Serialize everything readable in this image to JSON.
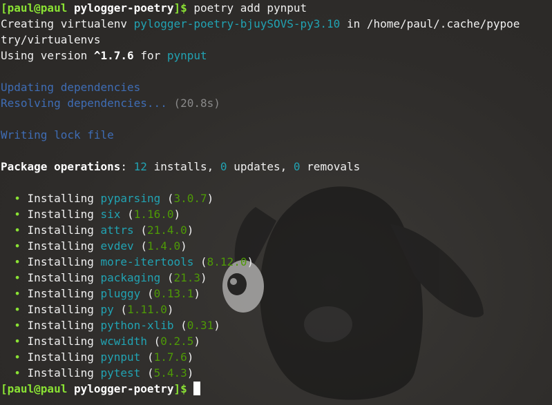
{
  "prompt": {
    "user_host": "[paul@paul",
    "cwd": "pylogger-poetry",
    "close": "]$"
  },
  "command": "poetry add pynput",
  "venv": {
    "prefix": "Creating virtualenv",
    "name": "pylogger-poetry-bjuySOVS-py3.10",
    "mid": "in",
    "path_part1": "/home/paul/.cache/pypoe",
    "path_part2": "try/virtualenvs"
  },
  "version_line": {
    "prefix": "Using version",
    "version": "^1.7.6",
    "for": "for",
    "package": "pynput"
  },
  "updating": "Updating dependencies",
  "resolving": {
    "text": "Resolving dependencies...",
    "time": "(20.8s)"
  },
  "writing": "Writing lock file",
  "operations": {
    "label": "Package operations",
    "installs_count": "12",
    "installs_label": "installs,",
    "updates_count": "0",
    "updates_label": "updates,",
    "removals_count": "0",
    "removals_label": "removals"
  },
  "install_verb": "Installing",
  "bullet": "•",
  "packages": [
    {
      "name": "pyparsing",
      "version": "3.0.7"
    },
    {
      "name": "six",
      "version": "1.16.0"
    },
    {
      "name": "attrs",
      "version": "21.4.0"
    },
    {
      "name": "evdev",
      "version": "1.4.0"
    },
    {
      "name": "more-itertools",
      "version": "8.12.0"
    },
    {
      "name": "packaging",
      "version": "21.3"
    },
    {
      "name": "pluggy",
      "version": "0.13.1"
    },
    {
      "name": "py",
      "version": "1.11.0"
    },
    {
      "name": "python-xlib",
      "version": "0.31"
    },
    {
      "name": "wcwidth",
      "version": "0.2.5"
    },
    {
      "name": "pynput",
      "version": "1.7.6"
    },
    {
      "name": "pytest",
      "version": "5.4.3"
    }
  ],
  "colors": {
    "background": "#302e2c",
    "prompt_green": "#8ae234",
    "package_cyan": "#21a3b3",
    "status_blue": "#3f6db5",
    "version_green": "#4e9a06"
  }
}
